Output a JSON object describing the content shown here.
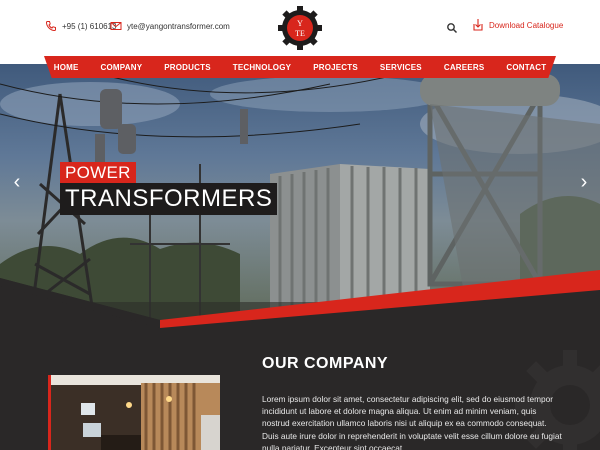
{
  "header": {
    "phone": "+95 (1) 610613",
    "email": "yte@yangontransformer.com",
    "logo_text": "YTE",
    "download_label": "Download Catalogue"
  },
  "nav": {
    "items": [
      "HOME",
      "COMPANY",
      "PRODUCTS",
      "TECHNOLOGY",
      "PROJECTS",
      "SERVICES",
      "CAREERS",
      "CONTACT"
    ]
  },
  "hero": {
    "caption_line1": "POWER",
    "caption_line2": "TRANSFORMERS"
  },
  "company": {
    "title": "OUR COMPANY",
    "text": "Lorem ipsum dolor sit amet, consectetur adipiscing elit, sed do eiusmod tempor incididunt ut labore et dolore magna aliqua. Ut enim ad minim veniam, quis nostrud exercitation ullamco laboris nisi ut aliquip ex ea commodo consequat. Duis aute irure dolor in reprehenderit in voluptate velit esse cillum dolore eu fugiat nulla pariatur. Excepteur sint occaecat"
  },
  "colors": {
    "accent": "#d8261c",
    "dark": "#2a2828"
  }
}
